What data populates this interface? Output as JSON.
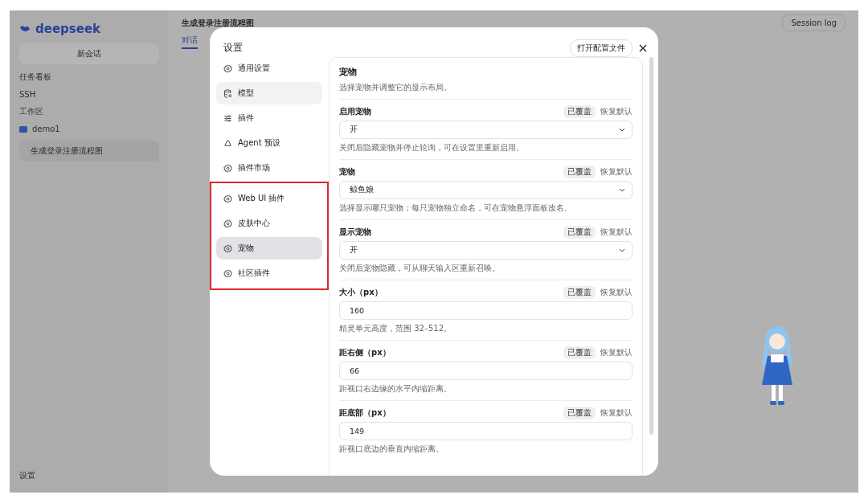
{
  "app": {
    "logo": "deepseek",
    "new_chat": "新会话",
    "menu": [
      "任务看板",
      "SSH"
    ],
    "workspace_label": "工作区",
    "folder": "demo1",
    "conversation": "生成登录注册流程图",
    "settings": "设置",
    "page_title": "生成登录注册流程图",
    "tab": "对话",
    "session_log": "Session log"
  },
  "dialog": {
    "title": "设置",
    "open_config": "打开配置文件",
    "nav_groups": [
      {
        "highlighted": false,
        "items": [
          {
            "label": "通用设置",
            "selected": false,
            "hovered": false
          },
          {
            "label": "模型",
            "selected": false,
            "hovered": true
          },
          {
            "label": "插件",
            "selected": false,
            "hovered": false
          },
          {
            "label": "Agent 预设",
            "selected": false,
            "hovered": false
          },
          {
            "label": "插件市场",
            "selected": false,
            "hovered": false
          }
        ]
      },
      {
        "highlighted": true,
        "items": [
          {
            "label": "Web UI 插件",
            "selected": false,
            "hovered": false
          },
          {
            "label": "皮肤中心",
            "selected": false,
            "hovered": false
          },
          {
            "label": "宠物",
            "selected": true,
            "hovered": false
          },
          {
            "label": "社区插件",
            "selected": false,
            "hovered": false
          }
        ]
      }
    ],
    "section": {
      "title": "宠物",
      "subtitle": "选择宠物并调整它的显示布局。",
      "fields": [
        {
          "kind": "select",
          "label": "启用宠物",
          "badge": "已覆盖",
          "reset": "恢复默认",
          "value": "开",
          "hint": "关闭后隐藏宠物并停止轮询，可在设置里重新启用。"
        },
        {
          "kind": "select",
          "label": "宠物",
          "badge": "已覆盖",
          "reset": "恢复默认",
          "value": "鲸鱼娘",
          "hint": "选择显示哪只宠物；每只宠物独立命名，可在宠物悬浮面板改名。"
        },
        {
          "kind": "select",
          "label": "显示宠物",
          "badge": "已覆盖",
          "reset": "恢复默认",
          "value": "开",
          "hint": "关闭后宠物隐藏，可从聊天输入区重新召唤。"
        },
        {
          "kind": "input",
          "label": "大小（px）",
          "badge": "已覆盖",
          "reset": "恢复默认",
          "value": "160",
          "hint": "精灵单元高度，范围 32–512。"
        },
        {
          "kind": "input",
          "label": "距右侧（px）",
          "badge": "已覆盖",
          "reset": "恢复默认",
          "value": "66",
          "hint": "距视口右边缘的水平内缩距离。"
        },
        {
          "kind": "input",
          "label": "距底部（px）",
          "badge": "已覆盖",
          "reset": "恢复默认",
          "value": "149",
          "hint": "距视口底边的垂直内缩距离。"
        }
      ]
    }
  }
}
